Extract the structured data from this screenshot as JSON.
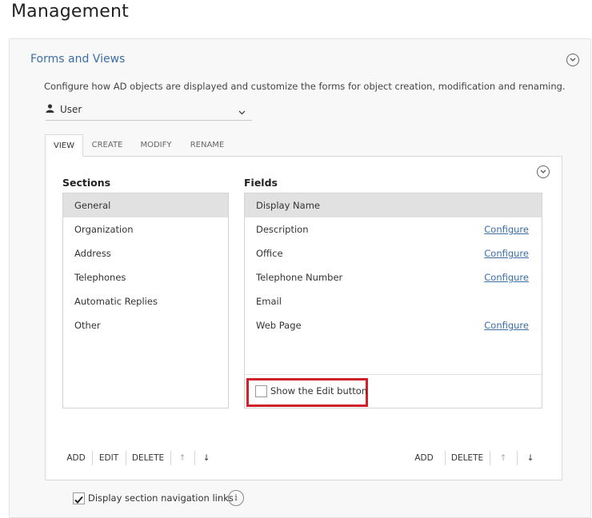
{
  "page_title": "Management",
  "card": {
    "title": "Forms and Views",
    "description": "Configure how AD objects are displayed and customize the forms for object creation, modification and renaming.",
    "object_type": {
      "selected": "User",
      "icon": "user-icon"
    }
  },
  "tabs": [
    {
      "label": "VIEW",
      "active": true
    },
    {
      "label": "CREATE",
      "active": false
    },
    {
      "label": "MODIFY",
      "active": false
    },
    {
      "label": "RENAME",
      "active": false
    }
  ],
  "sections": {
    "heading": "Sections",
    "items": [
      {
        "label": "General",
        "selected": true
      },
      {
        "label": "Organization",
        "selected": false
      },
      {
        "label": "Address",
        "selected": false
      },
      {
        "label": "Telephones",
        "selected": false
      },
      {
        "label": "Automatic Replies",
        "selected": false
      },
      {
        "label": "Other",
        "selected": false
      }
    ],
    "buttons": {
      "add": "ADD",
      "edit": "EDIT",
      "delete": "DELETE",
      "up": "↑",
      "down": "↓"
    }
  },
  "fields": {
    "heading": "Fields",
    "items": [
      {
        "label": "Display Name",
        "selected": true,
        "link": ""
      },
      {
        "label": "Description",
        "selected": false,
        "link": "Configure"
      },
      {
        "label": "Office",
        "selected": false,
        "link": "Configure"
      },
      {
        "label": "Telephone Number",
        "selected": false,
        "link": "Configure"
      },
      {
        "label": "Email",
        "selected": false,
        "link": ""
      },
      {
        "label": "Web Page",
        "selected": false,
        "link": "Configure"
      }
    ],
    "show_edit_button": {
      "label": "Show the Edit button",
      "checked": false
    },
    "buttons": {
      "add": "ADD",
      "delete": "DELETE",
      "up": "↑",
      "down": "↓"
    }
  },
  "display_nav_links": {
    "label": "Display section navigation links",
    "checked": true,
    "info": "i"
  },
  "colors": {
    "link": "#3b6ea5",
    "highlight": "#d0202a",
    "selected_row": "#e1e1e1"
  }
}
